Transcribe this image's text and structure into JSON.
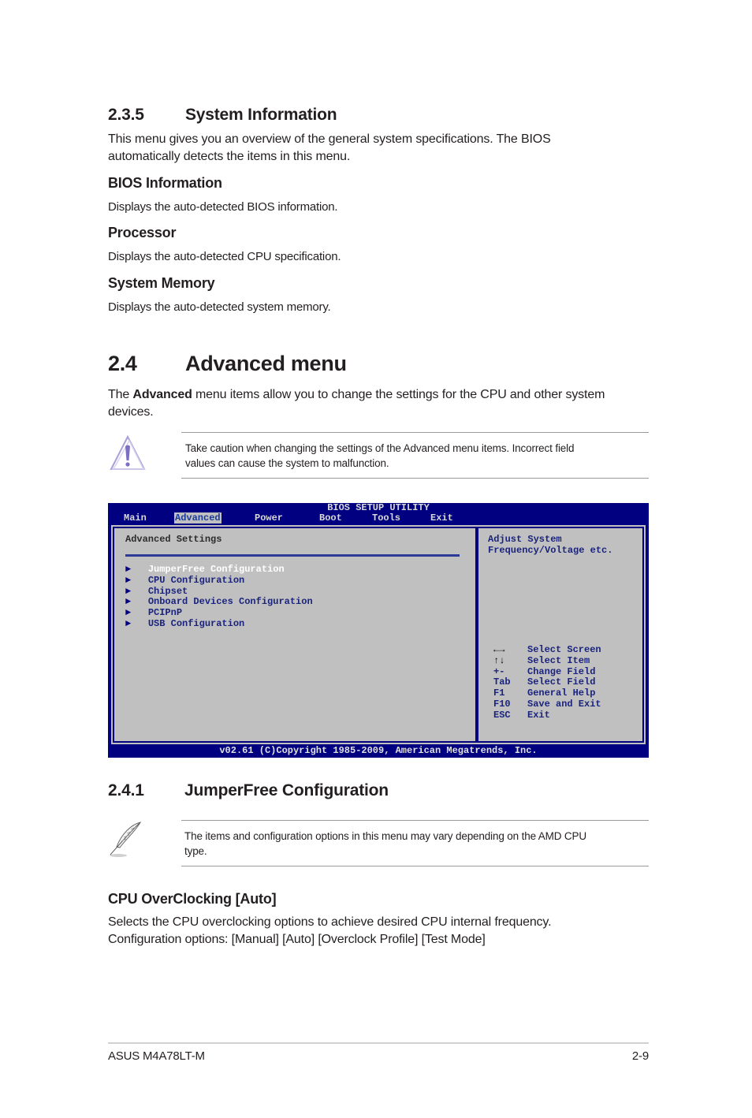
{
  "section_235": {
    "number": "2.3.5",
    "title": "System Information",
    "intro_line1": "This menu gives you an overview of the general system specifications. The BIOS",
    "intro_line2": "automatically detects the items in this menu.",
    "items": [
      {
        "heading": "BIOS Information",
        "text": "Displays the auto-detected BIOS information."
      },
      {
        "heading": "Processor",
        "text": "Displays the auto-detected CPU specification."
      },
      {
        "heading": "System Memory",
        "text": "Displays the auto-detected system memory."
      }
    ]
  },
  "section_24": {
    "number": "2.4",
    "title": "Advanced menu",
    "intro_pre": "The ",
    "intro_bold": "Advanced",
    "intro_post": " menu items allow you to change the settings for the CPU and other system",
    "intro_line2": "devices.",
    "caution_icon": "warning-triangle-icon",
    "caution_line1": "Take caution when changing the settings of the Advanced menu items. Incorrect field",
    "caution_line2": "values can cause the system to malfunction."
  },
  "bios": {
    "title": "BIOS SETUP UTILITY",
    "tabs": [
      "Main",
      "Advanced",
      "Power",
      "Boot",
      "Tools",
      "Exit"
    ],
    "active_tab": "Advanced",
    "section_title": "Advanced Settings",
    "menu_items": [
      "JumperFree Configuration",
      "CPU Configuration",
      "Chipset",
      "Onboard Devices Configuration",
      "PCIPnP",
      "USB Configuration"
    ],
    "selected_item": "JumperFree Configuration",
    "help_line1": "Adjust System",
    "help_line2": "Frequency/Voltage etc.",
    "keys": [
      {
        "key": "←→",
        "action": "Select Screen"
      },
      {
        "key": "↑↓",
        "action": "Select Item"
      },
      {
        "key": "+-",
        "action": "Change Field"
      },
      {
        "key": "Tab",
        "action": "Select Field"
      },
      {
        "key": "F1",
        "action": "General Help"
      },
      {
        "key": "F10",
        "action": "Save and Exit"
      },
      {
        "key": "ESC",
        "action": "Exit"
      }
    ],
    "footer": "v02.61 (C)Copyright 1985-2009, American Megatrends, Inc.",
    "colors": {
      "background": "#000080",
      "panel": "#c0c0c0",
      "text_blue": "#1a237e",
      "highlight": "#ffffff"
    }
  },
  "section_241": {
    "number": "2.4.1",
    "title": "JumperFree Configuration",
    "note_icon": "feather-pen-icon",
    "note_line1": "The items and configuration options in this menu may vary depending on the AMD CPU",
    "note_line2": "type.",
    "setting_heading": "CPU OverClocking [Auto]",
    "setting_line1": "Selects the CPU overclocking options to achieve desired CPU internal frequency.",
    "setting_line2": "Configuration options: [Manual] [Auto] [Overclock Profile] [Test Mode]"
  },
  "footer": {
    "product": "ASUS M4A78LT-M",
    "page": "2-9"
  }
}
